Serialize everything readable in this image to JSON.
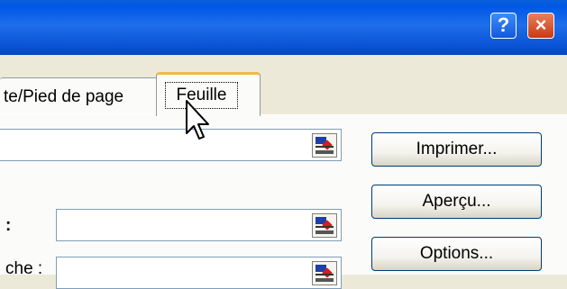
{
  "window": {
    "help_glyph": "?",
    "close_glyph": "×"
  },
  "tabs": [
    {
      "label": "te/Pied de page"
    },
    {
      "label": "Feuille",
      "active": true
    }
  ],
  "labels": {
    "row2": ":",
    "row3": "che :"
  },
  "buttons": {
    "print": "Imprimer...",
    "preview": "Aperçu...",
    "options": "Options..."
  },
  "icons": {
    "range_picker": "range-picker-icon",
    "cursor": "mouse-pointer-icon"
  }
}
